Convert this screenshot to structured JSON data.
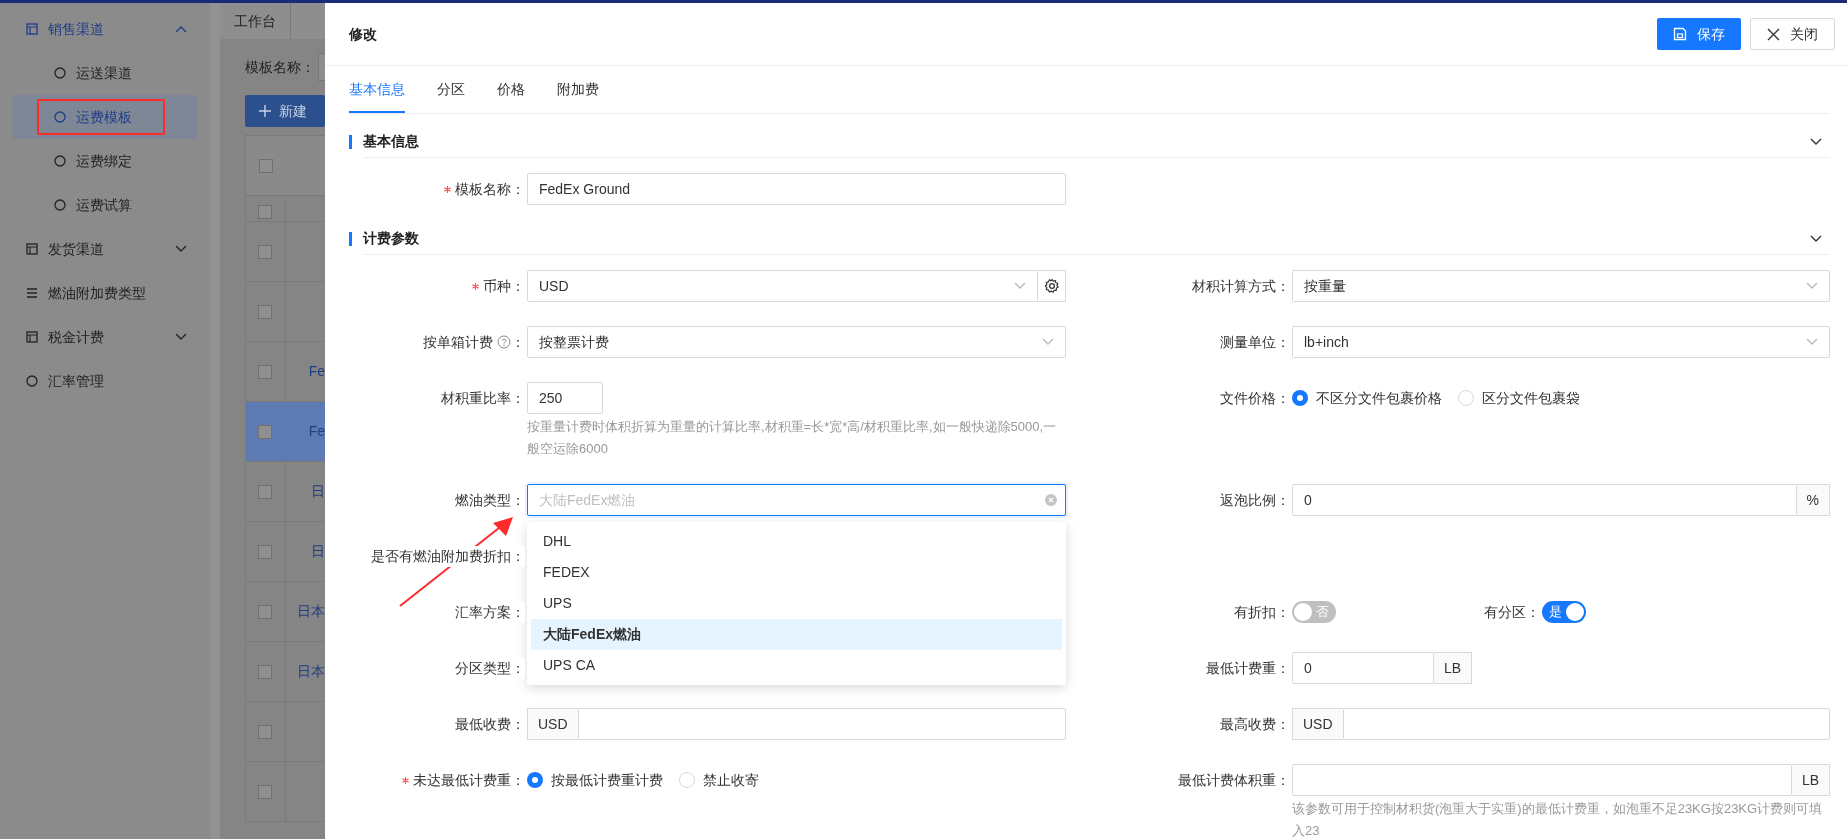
{
  "sidebar": {
    "items": [
      {
        "label": "销售渠道",
        "kind": "group",
        "expanded": true,
        "selected": true,
        "children": [
          {
            "label": "运送渠道",
            "selected": false
          },
          {
            "label": "运费模板",
            "selected": true
          },
          {
            "label": "运费绑定",
            "selected": false
          },
          {
            "label": "运费试算",
            "selected": false
          }
        ]
      },
      {
        "label": "发货渠道",
        "kind": "group",
        "expanded": false,
        "selected": false
      },
      {
        "label": "燃油附加费类型",
        "kind": "link",
        "selected": false
      },
      {
        "label": "税金计费",
        "kind": "group",
        "expanded": false,
        "selected": false
      },
      {
        "label": "汇率管理",
        "kind": "link",
        "selected": false
      }
    ]
  },
  "page_tabs": [
    {
      "label": "工作台",
      "selected": false
    }
  ],
  "filter": {
    "label": "模板名称："
  },
  "new_button": {
    "label": "新建"
  },
  "table": {
    "all_checked": false,
    "rows": [
      {
        "selected": false,
        "checked": false
      },
      {
        "selected": false,
        "checked": false
      },
      {
        "selected": false,
        "checked": false
      },
      {
        "selected": false,
        "checked": false,
        "name": "Fe"
      },
      {
        "selected": true,
        "checked": false,
        "name": "Fe"
      },
      {
        "selected": false,
        "checked": false,
        "name": "日"
      },
      {
        "selected": false,
        "checked": false,
        "name": "日"
      },
      {
        "selected": false,
        "checked": false,
        "name": "日本"
      },
      {
        "selected": false,
        "checked": false,
        "name": "日本"
      },
      {
        "selected": false,
        "checked": false
      },
      {
        "selected": false,
        "checked": false
      }
    ]
  },
  "dialog": {
    "title": "修改",
    "buttons": [
      {
        "label": "保存",
        "kind": "primary"
      },
      {
        "label": "关闭",
        "kind": "default"
      }
    ],
    "tabs": [
      {
        "label": "基本信息",
        "selected": true
      },
      {
        "label": "分区",
        "selected": false
      },
      {
        "label": "价格",
        "selected": false
      },
      {
        "label": "附加费",
        "selected": false
      }
    ],
    "sections": [
      {
        "title": "基本信息",
        "rows": [
          {
            "left": {
              "label": "模板名称：",
              "required": true,
              "kind": "text",
              "value": "FedEx Ground"
            }
          }
        ]
      },
      {
        "title": "计费参数",
        "rows": [
          {
            "left": {
              "label": "币种：",
              "required": true,
              "kind": "select_gear",
              "value": "USD"
            },
            "right": {
              "label": "材积计算方式：",
              "kind": "select",
              "value": "按重量"
            }
          },
          {
            "left": {
              "label": "按单箱计费",
              "help": true,
              "colon": "：",
              "kind": "select",
              "value": "按整票计费"
            },
            "right": {
              "label": "测量单位：",
              "kind": "select",
              "value": "lb+inch"
            }
          },
          {
            "left": {
              "label": "材积重比率：",
              "kind": "short",
              "value": "250",
              "hint": "按重量计费时体积折算为重量的计算比率,材积重=长*宽*高/材积重比率,如一般快递除5000,一般空运除6000"
            },
            "right": {
              "label": "文件价格：",
              "kind": "radio",
              "options": [
                {
                  "label": "不区分文件包裹价格",
                  "selected": true
                },
                {
                  "label": "区分文件包裹袋",
                  "selected": false
                }
              ]
            }
          },
          {
            "left": {
              "label": "燃油类型：",
              "kind": "combo",
              "placeholder": "大陆FedEx燃油",
              "options": [
                {
                  "label": "DHL",
                  "selected": false
                },
                {
                  "label": "FEDEX",
                  "selected": false
                },
                {
                  "label": "UPS",
                  "selected": false
                },
                {
                  "label": "大陆FedEx燃油",
                  "selected": true
                },
                {
                  "label": "UPS CA",
                  "selected": false
                }
              ]
            },
            "right": {
              "label": "返泡比例：",
              "kind": "addon",
              "value": "0",
              "suffix": "%"
            }
          },
          {
            "left": {
              "label": "是否有燃油附加费折扣：",
              "kind": "label"
            }
          },
          {
            "left": {
              "label": "汇率方案：",
              "kind": "label"
            },
            "right": {
              "kind": "switches",
              "items": [
                {
                  "label": "有折扣：",
                  "on": false,
                  "text": "否"
                },
                {
                  "label": "有分区：",
                  "on": true,
                  "text": "是"
                }
              ]
            }
          },
          {
            "left": {
              "label": "分区类型：",
              "kind": "label"
            },
            "right": {
              "label": "最低计费重：",
              "kind": "addon_short",
              "value": "0",
              "suffix": "LB"
            }
          },
          {
            "left": {
              "label": "最低收费：",
              "kind": "addon",
              "prefix": "USD"
            },
            "right": {
              "label": "最高收费：",
              "kind": "addon",
              "prefix": "USD"
            }
          },
          {
            "left": {
              "label": "未达最低计费重：",
              "required": true,
              "kind": "radio",
              "options": [
                {
                  "label": "按最低计费重计费",
                  "selected": true
                },
                {
                  "label": "禁止收寄",
                  "selected": false
                }
              ]
            },
            "right": {
              "label": "最低计费体积重：",
              "kind": "addon",
              "suffix": "LB",
              "hint": "该参数可用于控制材积货(泡重大于实重)的最低计费重，如泡重不足23KG按23KG计费则可填入23"
            }
          }
        ]
      }
    ]
  }
}
